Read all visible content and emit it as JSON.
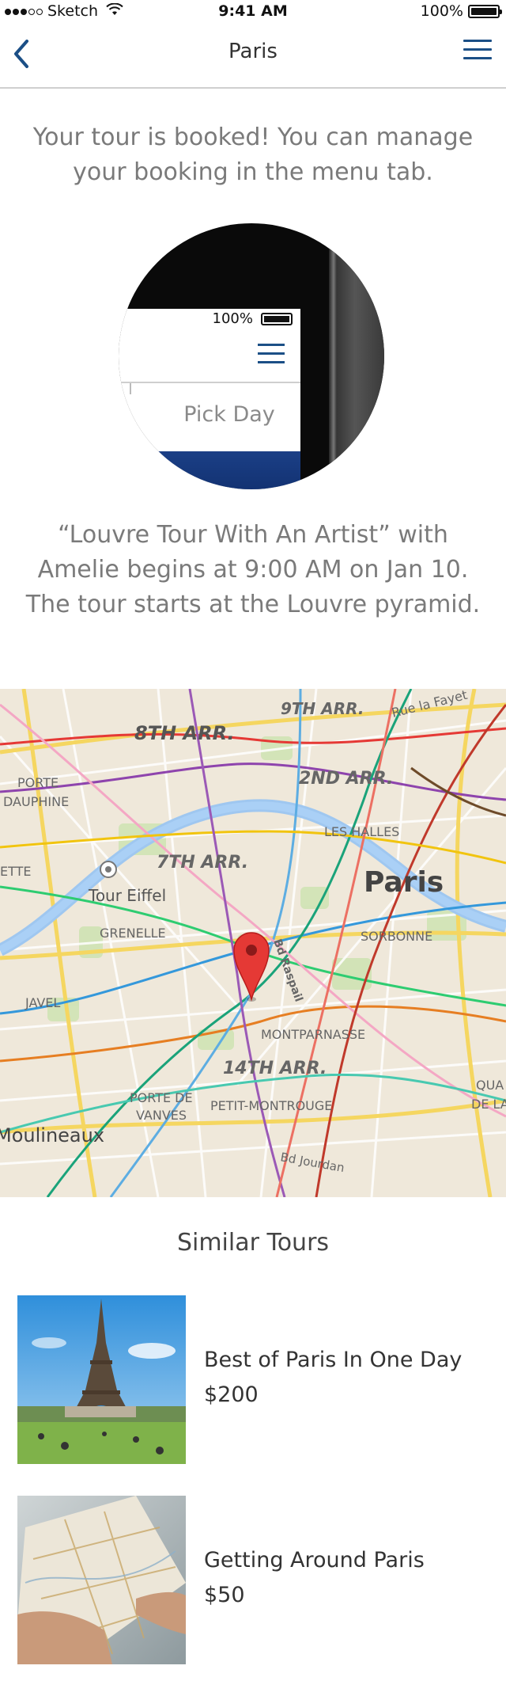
{
  "status_bar": {
    "carrier": "Sketch",
    "time": "9:41 AM",
    "battery": "100%"
  },
  "nav": {
    "title": "Paris",
    "back_icon": "chevron-left-icon",
    "menu_icon": "hamburger-menu-icon"
  },
  "booking": {
    "message": "Your tour is booked! You can manage your booking in the menu tab.",
    "illustration": {
      "battery": "100%",
      "pick_day": "Pick Day"
    },
    "details": "“Louvre Tour With An Artist” with Amelie begins at 9:00 AM on Jan 10. The tour starts at the Louvre pyramid."
  },
  "map": {
    "labels": {
      "arr9": "9TH ARR.",
      "rue": "Rue la Fayet",
      "arr8": "8TH ARR.",
      "porte": "PORTE",
      "dauphine": "DAUPHINE",
      "arr2": "2ND ARR.",
      "halles": "LES HALLES",
      "ette": "ETTE",
      "arr7": "7TH ARR.",
      "paris": "Paris",
      "eiffel": "Tour Eiffel",
      "grenelle": "GRENELLE",
      "sorbonne": "SORBONNE",
      "raspail": "Bd Raspail",
      "javel": "JAVEL",
      "montparnasse": "MONTPARNASSE",
      "arr14": "14TH ARR.",
      "qua": "QUA",
      "dela": "DE LA",
      "porte_de": "PORTE DE",
      "vanves": "VANVES",
      "petit": "PETIT-MONTROUGE",
      "moulineaux": "Moulineaux",
      "jourdan": "Bd Jourdan"
    },
    "pin_icon": "map-pin-icon",
    "accent": "#e53935"
  },
  "similar": {
    "title": "Similar Tours",
    "tours": [
      {
        "name": "Best of Paris In One Day",
        "price": "$200"
      },
      {
        "name": "Getting Around Paris",
        "price": "$50"
      }
    ]
  },
  "colors": {
    "accent": "#1b4f86",
    "text": "#7a7a7a"
  }
}
